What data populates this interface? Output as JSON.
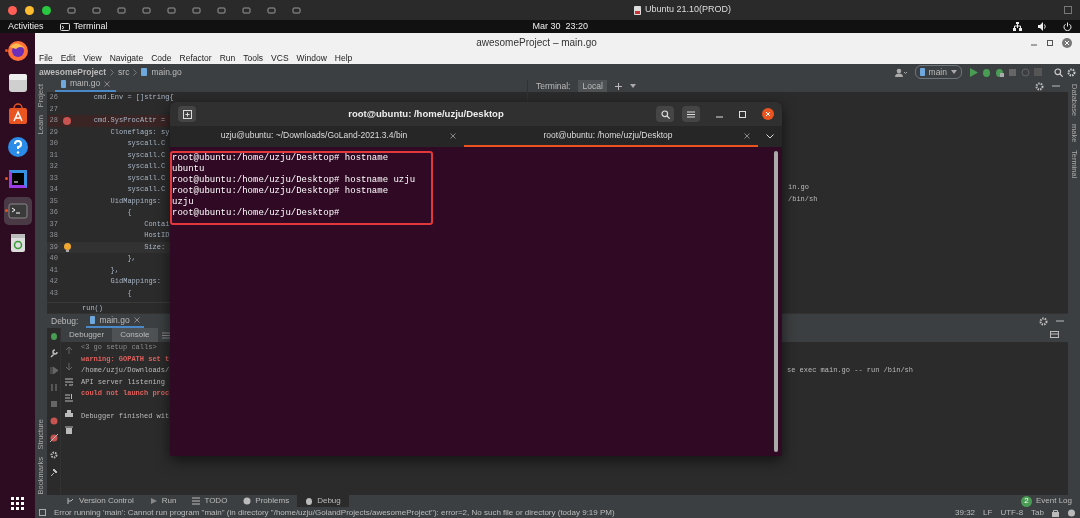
{
  "host_bar": {
    "title": "Ubuntu 21.10(PROD)"
  },
  "top_bar": {
    "activities": "Activities",
    "app": "Terminal",
    "clock": "Mar 30  23:20"
  },
  "dock": [
    {
      "kind": "firefox",
      "running": true,
      "selected": false
    },
    {
      "kind": "files",
      "running": false,
      "selected": false
    },
    {
      "kind": "software",
      "running": false,
      "selected": false
    },
    {
      "kind": "help",
      "running": false,
      "selected": false
    },
    {
      "kind": "goland",
      "running": true,
      "selected": false
    },
    {
      "kind": "terminal",
      "running": true,
      "selected": true
    },
    {
      "kind": "trash",
      "running": false,
      "selected": false
    }
  ],
  "ide": {
    "title": "awesomeProject – main.go",
    "menu": [
      "File",
      "Edit",
      "View",
      "Navigate",
      "Code",
      "Refactor",
      "Run",
      "Tools",
      "VCS",
      "Window",
      "Help"
    ],
    "breadcrumbs": [
      "awesomeProject",
      "src",
      "main.go"
    ],
    "run_config": "main",
    "left_stripe": [
      "Project",
      "Learn",
      "Structure",
      "Bookmarks"
    ],
    "right_stripe": [
      "Database",
      "make",
      "Terminal"
    ],
    "editor_tab": "main.go",
    "code_lines": [
      {
        "kind": "plain",
        "number": "26",
        "text": "\tcmd.Env = []string{"
      },
      {
        "kind": "plain",
        "number": "27"
      },
      {
        "kind": "breakpoint",
        "number": "28",
        "text": "\tcmd.SysProcAttr ="
      },
      {
        "kind": "plain",
        "number": "29",
        "text": "\t\tCloneflags: sy"
      },
      {
        "kind": "plain",
        "number": "30",
        "text": "\t\t\tsyscall.C"
      },
      {
        "kind": "plain",
        "number": "31",
        "text": "\t\t\tsyscall.C"
      },
      {
        "kind": "plain",
        "number": "32",
        "text": "\t\t\tsyscall.C"
      },
      {
        "kind": "plain",
        "number": "33",
        "text": "\t\t\tsyscall.C"
      },
      {
        "kind": "plain",
        "number": "34",
        "text": "\t\t\tsyscall.C"
      },
      {
        "kind": "plain",
        "number": "35",
        "text": "\t\tUidMappings:"
      },
      {
        "kind": "plain",
        "number": "36",
        "text": "\t\t\t{"
      },
      {
        "kind": "plain",
        "number": "37",
        "text": "\t\t\t\tContai"
      },
      {
        "kind": "plain",
        "number": "38",
        "text": "\t\t\t\tHostID"
      },
      {
        "kind": "bulb",
        "number": "39",
        "text": "\t\t\t\tSize:"
      },
      {
        "kind": "plain",
        "number": "40",
        "text": "\t\t\t},"
      },
      {
        "kind": "plain",
        "number": "41",
        "text": "\t\t},"
      },
      {
        "kind": "plain",
        "number": "42",
        "text": "\t\tGidMappings:"
      },
      {
        "kind": "plain",
        "number": "43",
        "text": "\t\t\t{"
      }
    ],
    "sticky_line": "run()",
    "terminal_tool": {
      "label": "Terminal:",
      "tab": "Local",
      "lines": [
        "in.go",
        "/bin/sh"
      ]
    },
    "debug": {
      "label": "Debug:",
      "tab": "main.go",
      "subtabs": [
        {
          "label": "Debugger",
          "selected": false
        },
        {
          "label": "Console",
          "selected": true
        }
      ],
      "console": [
        {
          "kind": "fold",
          "text": "<3 go setup calls>"
        },
        {
          "kind": "error",
          "text": "warning: GOPATH set t"
        },
        {
          "kind": "plain",
          "text": "/home/uzju/Downloads/",
          "tail": "se exec main.go -- run /bin/sh"
        },
        {
          "kind": "plain",
          "text": "API server listening"
        },
        {
          "kind": "error",
          "text": "could not launch proc"
        },
        {
          "kind": "blank"
        },
        {
          "kind": "plain",
          "text": "Debugger finished wit"
        }
      ]
    },
    "tool_tabs": [
      {
        "label": "Version Control",
        "selected": false
      },
      {
        "label": "Run",
        "selected": false
      },
      {
        "label": "TODO",
        "selected": false
      },
      {
        "label": "Problems",
        "selected": false
      },
      {
        "label": "Debug",
        "selected": true
      }
    ],
    "status": {
      "message": "Error running 'main': Cannot run program \"main\" (in directory \"/home/uzju/GolandProjects/awesomeProject\"): error=2, No such file or directory (today 9:19 PM)",
      "position": "39:32",
      "line_separator": "LF",
      "encoding": "UTF-8",
      "indent": "Tab",
      "event_count": "2",
      "event_log": "Event Log"
    }
  },
  "terminal_window": {
    "title": "root@ubuntu: /home/uzju/Desktop",
    "tabs": [
      {
        "label": "uzju@ubuntu: ~/Downloads/GoLand-2021.3.4/bin",
        "selected": false
      },
      {
        "label": "root@ubuntu: /home/uzju/Desktop",
        "selected": true
      }
    ],
    "highlighted": true,
    "lines": [
      "root@ubuntu:/home/uzju/Desktop# hostname",
      "ubuntu",
      "root@ubuntu:/home/uzju/Desktop# hostname uzju",
      "root@ubuntu:/home/uzju/Desktop# hostname",
      "uzju",
      "root@ubuntu:/home/uzju/Desktop#"
    ]
  }
}
